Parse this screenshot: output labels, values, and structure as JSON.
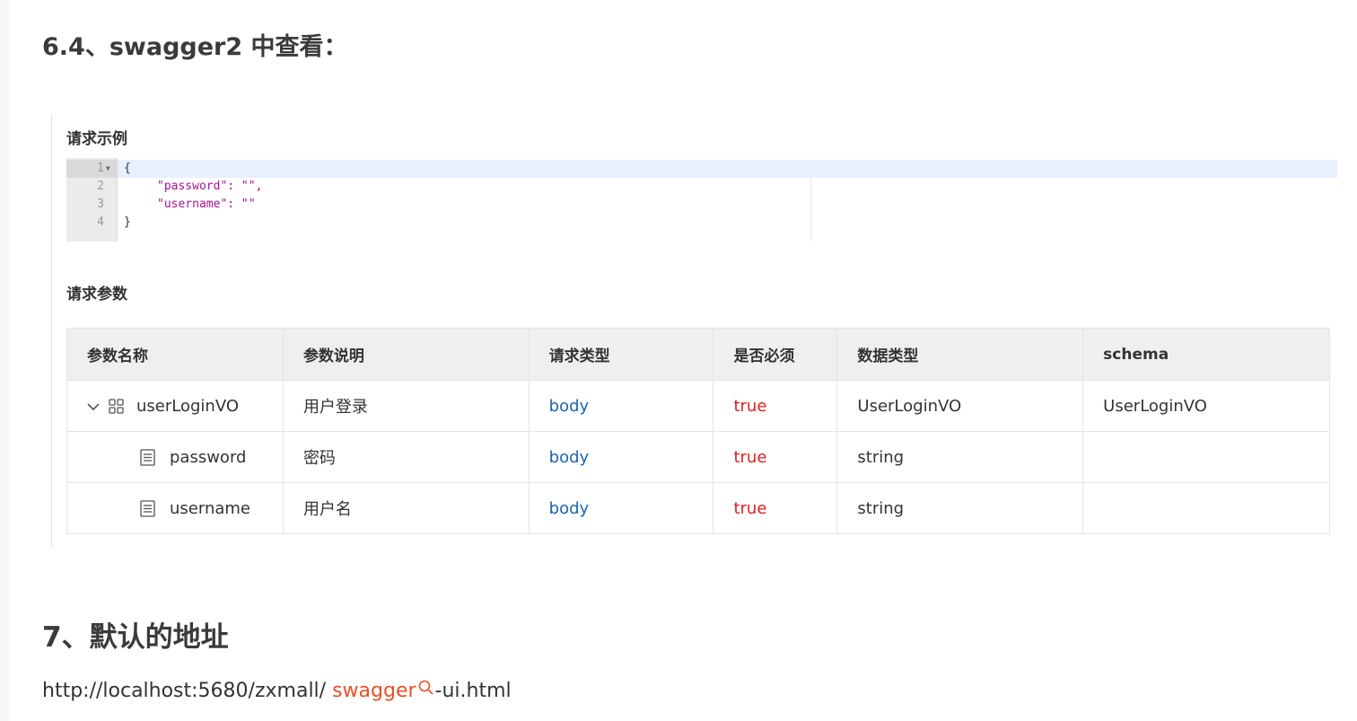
{
  "headings": {
    "section_64": "6.4、swagger2 中查看：",
    "section_7": "7、默认的地址"
  },
  "screenshot": {
    "request_example_label": "请求示例",
    "request_params_label": "请求参数",
    "editor": {
      "line_numbers": [
        "1",
        "2",
        "3",
        "4"
      ],
      "lines": [
        "{",
        "\"password\": \"\",",
        "\"username\": \"\"",
        "}"
      ]
    },
    "table": {
      "headers": [
        "参数名称",
        "参数说明",
        "请求类型",
        "是否必须",
        "数据类型",
        "schema"
      ],
      "rows": [
        {
          "name": "userLoginVO",
          "desc": "用户登录",
          "type": "body",
          "required": "true",
          "data_type": "UserLoginVO",
          "schema": "UserLoginVO"
        },
        {
          "name": "password",
          "desc": "密码",
          "type": "body",
          "required": "true",
          "data_type": "string",
          "schema": ""
        },
        {
          "name": "username",
          "desc": "用户名",
          "type": "body",
          "required": "true",
          "data_type": "string",
          "schema": ""
        }
      ]
    }
  },
  "url": {
    "prefix": "http://localhost:5680/zxmall/ ",
    "link": "swagger",
    "suffix": "-ui.html"
  },
  "colors": {
    "link": "#e5512a",
    "body_type": "#1e62b0",
    "required_true": "#e02020"
  }
}
